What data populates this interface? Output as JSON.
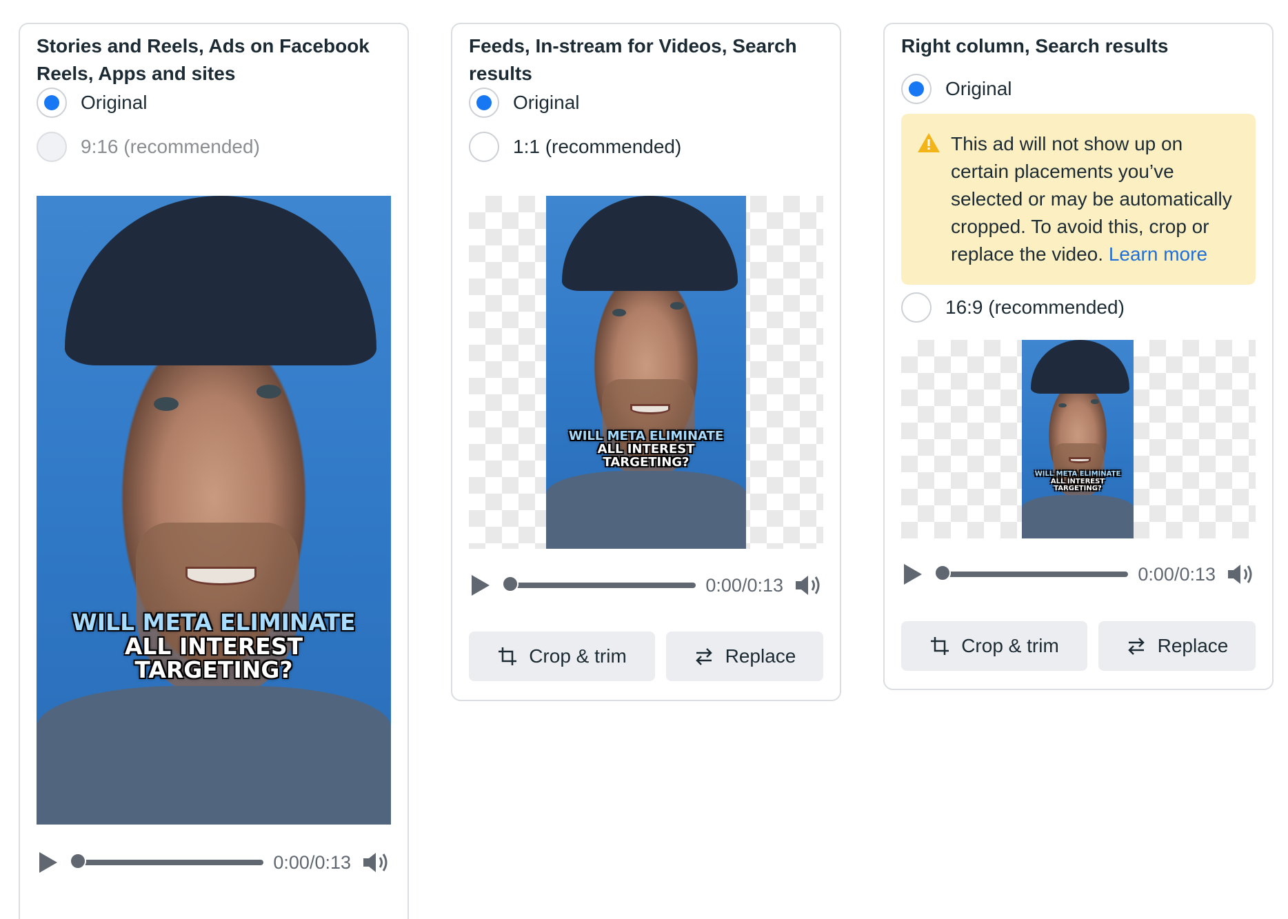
{
  "panels": [
    {
      "title": "Stories and Reels, Ads on Facebook Reels, Apps and sites",
      "options": [
        {
          "label": "Original",
          "selected": true,
          "disabled": false
        },
        {
          "label": "9:16 (recommended)",
          "selected": false,
          "disabled": true
        }
      ],
      "video_caption": [
        "WILL META ELIMINATE",
        "ALL INTEREST",
        "TARGETING?"
      ],
      "player": {
        "time": "0:00/0:13",
        "progress": 0
      }
    },
    {
      "title": "Feeds, In-stream for Videos, Search results",
      "options": [
        {
          "label": "Original",
          "selected": true,
          "disabled": false
        },
        {
          "label": "1:1 (recommended)",
          "selected": false,
          "disabled": false
        }
      ],
      "video_caption": [
        "WILL META ELIMINATE",
        "ALL INTEREST",
        "TARGETING?"
      ],
      "player": {
        "time": "0:00/0:13",
        "progress": 0
      },
      "buttons": {
        "crop": "Crop & trim",
        "replace": "Replace"
      }
    },
    {
      "title": "Right column, Search results",
      "options": [
        {
          "label": "Original",
          "selected": true,
          "disabled": false
        },
        {
          "label": "16:9 (recommended)",
          "selected": false,
          "disabled": false
        }
      ],
      "warning": {
        "text": "This ad will not show up on certain placements you’ve selected or may be automatically cropped. To avoid this, crop or replace the video.",
        "link": "Learn more"
      },
      "video_caption": [
        "WILL META ELIMINATE",
        "ALL INTEREST",
        "TARGETING?"
      ],
      "player": {
        "time": "0:00/0:13",
        "progress": 0
      },
      "buttons": {
        "crop": "Crop & trim",
        "replace": "Replace"
      }
    }
  ],
  "icons": {
    "play": "play-icon",
    "volume": "volume-icon",
    "crop": "crop-icon",
    "replace": "swap-arrows-icon",
    "warning": "warning-triangle-icon"
  },
  "colors": {
    "radio_selected": "#1877f2",
    "warning_bg": "#fcf0c3",
    "warning_icon": "#f2b418",
    "link": "#1e6ed8"
  }
}
